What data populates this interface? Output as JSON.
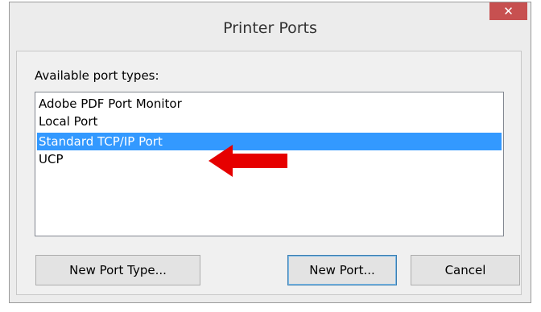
{
  "window": {
    "title": "Printer Ports",
    "close_label": "✕"
  },
  "group": {
    "label": "Available port types:"
  },
  "list": {
    "items": [
      {
        "label": "Adobe PDF Port Monitor",
        "selected": false
      },
      {
        "label": "Local Port",
        "selected": false
      },
      {
        "label": "Standard TCP/IP Port",
        "selected": true
      },
      {
        "label": "UCP",
        "selected": false
      }
    ]
  },
  "annotation": {
    "icon": "red-arrow-left",
    "color": "#e60000"
  },
  "buttons": {
    "new_port_type": "New Port Type...",
    "new_port": "New Port...",
    "cancel": "Cancel"
  },
  "colors": {
    "selection": "#3399ff",
    "close": "#c75050"
  }
}
